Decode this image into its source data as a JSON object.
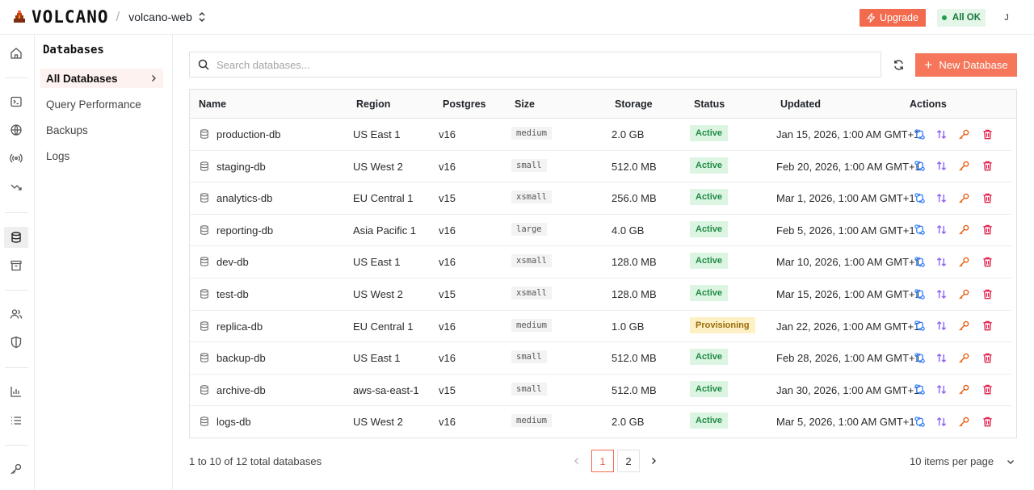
{
  "app": {
    "logo_text": "VOLCANO",
    "project": "volcano-web"
  },
  "header": {
    "upgrade_label": "Upgrade",
    "status_label": "All OK",
    "avatar_initial": "J"
  },
  "subnav": {
    "title": "Databases",
    "items": [
      {
        "label": "All Databases",
        "active": true
      },
      {
        "label": "Query Performance"
      },
      {
        "label": "Backups"
      },
      {
        "label": "Logs"
      }
    ]
  },
  "search": {
    "placeholder": "Search databases..."
  },
  "toolbar": {
    "new_label": "New Database"
  },
  "table": {
    "columns": [
      "Name",
      "Region",
      "Postgres",
      "Size",
      "Storage",
      "Status",
      "Updated",
      "Actions"
    ],
    "rows": [
      {
        "name": "production-db",
        "region": "US East 1",
        "postgres": "v16",
        "size": "medium",
        "storage": "2.0 GB",
        "status": "Active",
        "updated": "Jan 15, 2026, 1:00 AM GMT+1"
      },
      {
        "name": "staging-db",
        "region": "US West 2",
        "postgres": "v16",
        "size": "small",
        "storage": "512.0 MB",
        "status": "Active",
        "updated": "Feb 20, 2026, 1:00 AM GMT+1"
      },
      {
        "name": "analytics-db",
        "region": "EU Central 1",
        "postgres": "v15",
        "size": "xsmall",
        "storage": "256.0 MB",
        "status": "Active",
        "updated": "Mar 1, 2026, 1:00 AM GMT+1"
      },
      {
        "name": "reporting-db",
        "region": "Asia Pacific 1",
        "postgres": "v16",
        "size": "large",
        "storage": "4.0 GB",
        "status": "Active",
        "updated": "Feb 5, 2026, 1:00 AM GMT+1"
      },
      {
        "name": "dev-db",
        "region": "US East 1",
        "postgres": "v16",
        "size": "xsmall",
        "storage": "128.0 MB",
        "status": "Active",
        "updated": "Mar 10, 2026, 1:00 AM GMT+1"
      },
      {
        "name": "test-db",
        "region": "US West 2",
        "postgres": "v15",
        "size": "xsmall",
        "storage": "128.0 MB",
        "status": "Active",
        "updated": "Mar 15, 2026, 1:00 AM GMT+1"
      },
      {
        "name": "replica-db",
        "region": "EU Central 1",
        "postgres": "v16",
        "size": "medium",
        "storage": "1.0 GB",
        "status": "Provisioning",
        "updated": "Jan 22, 2026, 1:00 AM GMT+1"
      },
      {
        "name": "backup-db",
        "region": "US East 1",
        "postgres": "v16",
        "size": "small",
        "storage": "512.0 MB",
        "status": "Active",
        "updated": "Feb 28, 2026, 1:00 AM GMT+1"
      },
      {
        "name": "archive-db",
        "region": "aws-sa-east-1",
        "postgres": "v15",
        "size": "small",
        "storage": "512.0 MB",
        "status": "Active",
        "updated": "Jan 30, 2026, 1:00 AM GMT+1"
      },
      {
        "name": "logs-db",
        "region": "US West 2",
        "postgres": "v16",
        "size": "medium",
        "storage": "2.0 GB",
        "status": "Active",
        "updated": "Mar 5, 2026, 1:00 AM GMT+1"
      }
    ]
  },
  "pagination": {
    "info": "1 to 10 of 12 total databases",
    "pages": [
      "1",
      "2"
    ],
    "current": "1",
    "per_page_label": "10 items per page"
  },
  "rail_icons": [
    "home-icon",
    "terminal-icon",
    "globe-icon",
    "broadcast-icon",
    "flow-icon",
    "database-icon",
    "archive-icon",
    "users-icon",
    "shield-icon",
    "bar-chart-icon",
    "list-icon",
    "key-icon"
  ],
  "colors": {
    "accent": "#f26b4e",
    "active_green": "#1f8a45",
    "provisioning_amber": "#9a6a08",
    "action_blue": "#3b82f6",
    "action_purple": "#8b5cf6",
    "action_orange": "#ea580c",
    "action_red": "#e11d48"
  }
}
